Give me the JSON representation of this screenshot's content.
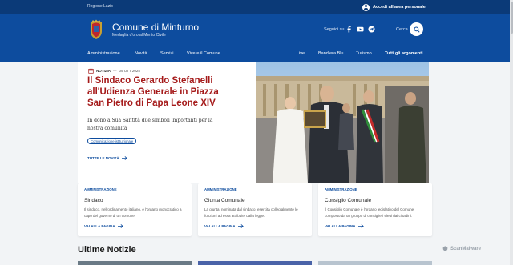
{
  "topbar": {
    "region": "Regione Lazio",
    "login_label": "Accedi all'area personale"
  },
  "header": {
    "title": "Comune di Minturno",
    "subtitle": "Medaglia d'oro al Merito Civile",
    "follow_label": "Seguici su",
    "search_label": "Cerca",
    "social": [
      "facebook-icon",
      "youtube-icon",
      "telegram-icon"
    ]
  },
  "nav": {
    "left": [
      "Amministrazione",
      "Novità",
      "Servizi",
      "Vivere il Comune"
    ],
    "right": [
      "Live",
      "Bandiera Blu",
      "Turismo"
    ],
    "all_topics": "Tutti gli argomenti..."
  },
  "hero": {
    "category": "NOTIZIA",
    "date": "09 OTT 2025",
    "title": "Il Sindaco Gerardo Stefanelli all'Udienza Generale in Piazza San Pietro di Papa Leone XIV",
    "description": "In dono a Sua Santità due simboli importanti per la nostra comunità",
    "tag": "Comunicazione istituzionale",
    "all_news": "TUTTE LE NOVITÀ"
  },
  "cards": [
    {
      "kicker": "AMMINISTRAZIONE",
      "title": "Sindaco",
      "description": "Il sindaco, nell'ordinamento italiano, è l'organo monocratico a capo del governo di un comune.",
      "link": "VAI ALLA PAGINA"
    },
    {
      "kicker": "AMMINISTRAZIONE",
      "title": "Giunta Comunale",
      "description": "La giunta, nominata dal sindaco, esercita collegialmente le funzioni ad essa attribuite dalla legge.",
      "link": "VAI ALLA PAGINA"
    },
    {
      "kicker": "AMMINISTRAZIONE",
      "title": "Consiglio Comunale",
      "description": "Il Consiglio Comunale è l'organo legislativo del Comune, composto da un gruppo di consiglieri eletti dai cittadini.",
      "link": "VAI ALLA PAGINA"
    }
  ],
  "latest": {
    "title": "Ultime Notizie"
  },
  "watermark": "ScanMalware",
  "colors": {
    "primary": "#0d4c9e",
    "topbar": "#0b3a78",
    "accent_title": "#a51a1a",
    "background": "#f2f4f6"
  }
}
